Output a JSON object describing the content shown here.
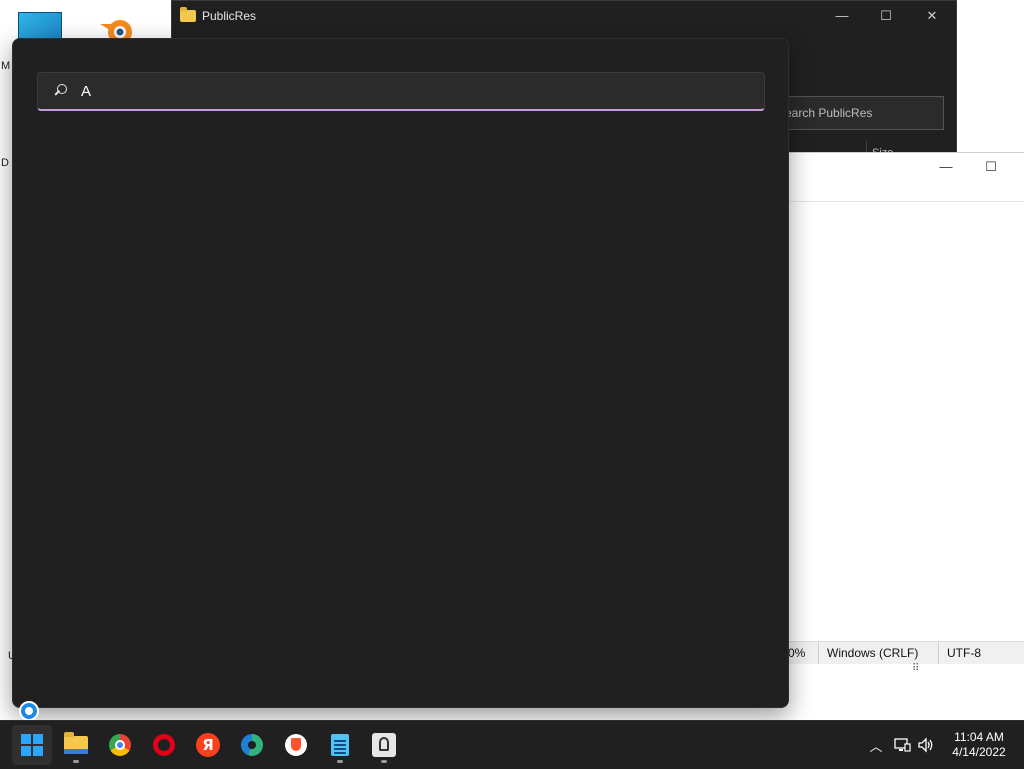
{
  "desktop": {
    "frag_m": "M",
    "frag_d": "D",
    "frag_u": "U"
  },
  "explorer": {
    "title": "PublicRes",
    "search_placeholder": "earch PublicRes",
    "size_column": "Size",
    "controls": {
      "minimize": "—",
      "maximize": "☐",
      "close": "✕"
    }
  },
  "notepad": {
    "controls": {
      "minimize": "—",
      "maximize": "☐"
    },
    "status": {
      "zoom": "0%",
      "line_ending": "Windows (CRLF)",
      "encoding": "UTF-8"
    }
  },
  "search_flyout": {
    "query": "A"
  },
  "taskbar": {
    "apps": [
      {
        "name": "start",
        "icon": "windows-logo-icon"
      },
      {
        "name": "file-explorer",
        "icon": "folder-icon",
        "running": true
      },
      {
        "name": "chrome",
        "icon": "chrome-icon"
      },
      {
        "name": "opera",
        "icon": "opera-icon"
      },
      {
        "name": "yandex",
        "icon": "yandex-icon",
        "glyph": "Я"
      },
      {
        "name": "edge",
        "icon": "edge-icon"
      },
      {
        "name": "brave",
        "icon": "brave-icon"
      },
      {
        "name": "notepad",
        "icon": "notepad-icon",
        "running": true
      },
      {
        "name": "tool",
        "icon": "snipping-tool-icon",
        "running": true
      }
    ],
    "tray": {
      "chevron": "︿",
      "network": "🖧",
      "volume": "🔊"
    },
    "clock": {
      "time": "11:04 AM",
      "date": "4/14/2022"
    }
  },
  "colors": {
    "accent_underline": "#c79bd7",
    "flyout_bg": "#202020",
    "taskbar_bg": "#202020"
  }
}
